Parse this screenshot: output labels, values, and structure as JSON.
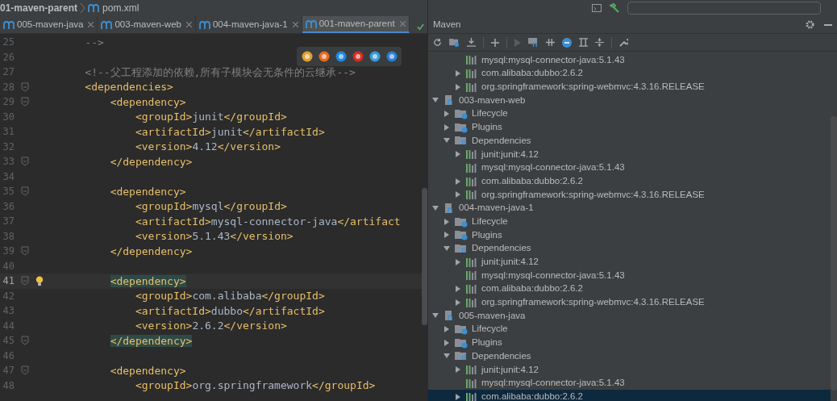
{
  "breadcrumb": [
    "01-maven-parent",
    "pom.xml"
  ],
  "tabs": [
    {
      "label": "005-maven-java",
      "selected": false
    },
    {
      "label": "003-maven-web",
      "selected": false
    },
    {
      "label": "004-maven-java-1",
      "selected": false
    },
    {
      "label": "001-maven-parent",
      "selected": true
    }
  ],
  "editor": {
    "lines": [
      {
        "number": "25",
        "kind": "comment",
        "text": "    -->"
      },
      {
        "number": "26",
        "kind": "code"
      },
      {
        "number": "27",
        "kind": "comment",
        "text": "    <!--父工程添加的依赖,所有子模块会无条件的云继承-->"
      },
      {
        "number": "28",
        "kind": "code",
        "text": "    <dependencies>",
        "fold": true
      },
      {
        "number": "29",
        "kind": "code",
        "text": "        <dependency>",
        "fold": true
      },
      {
        "number": "30",
        "kind": "code",
        "text": "            <groupId>junit</groupId>"
      },
      {
        "number": "31",
        "kind": "code",
        "text": "            <artifactId>junit</artifactId>"
      },
      {
        "number": "32",
        "kind": "code",
        "text": "            <version>4.12</version>"
      },
      {
        "number": "33",
        "kind": "code",
        "text": "        </dependency>",
        "fold": true
      },
      {
        "number": "34",
        "kind": "code"
      },
      {
        "number": "35",
        "kind": "code",
        "text": "        <dependency>",
        "fold": true
      },
      {
        "number": "36",
        "kind": "code",
        "text": "            <groupId>mysql</groupId>"
      },
      {
        "number": "37",
        "kind": "code",
        "text": "            <artifactId>mysql-connector-java</artifact"
      },
      {
        "number": "38",
        "kind": "code",
        "text": "            <version>5.1.43</version>"
      },
      {
        "number": "39",
        "kind": "code",
        "text": "        </dependency>",
        "fold": true
      },
      {
        "number": "40",
        "kind": "code"
      },
      {
        "number": "41",
        "kind": "code",
        "text": "        <dependency>",
        "fold": true,
        "current": true,
        "match_highlight": true,
        "bulb": true
      },
      {
        "number": "42",
        "kind": "code",
        "text": "            <groupId>com.alibaba</groupId>"
      },
      {
        "number": "43",
        "kind": "code",
        "text": "            <artifactId>dubbo</artifactId>"
      },
      {
        "number": "44",
        "kind": "code",
        "text": "            <version>2.6.2</version>"
      },
      {
        "number": "45",
        "kind": "code",
        "text": "        </dependency>",
        "fold": true,
        "match_highlight": true
      },
      {
        "number": "46",
        "kind": "code"
      },
      {
        "number": "47",
        "kind": "code",
        "text": "        <dependency>",
        "fold": true
      },
      {
        "number": "48",
        "kind": "code",
        "text": "            <groupId>org.springframework</groupId>"
      }
    ]
  },
  "maven": {
    "title": "Maven",
    "tree_top": [
      {
        "kind": "dependency",
        "label": "mysql:mysql-connector-java:5.1.43",
        "selected": false
      },
      {
        "kind": "dependency",
        "label": "com.alibaba:dubbo:2.6.2",
        "expanded": false,
        "selected": false
      },
      {
        "kind": "dependency",
        "label": "org.springframework:spring-webmvc:4.3.16.RELEASE",
        "expanded": false,
        "selected": false
      }
    ],
    "tree": [
      {
        "kind": "module",
        "label": "003-maven-web",
        "expanded": true,
        "selected": false,
        "children": [
          {
            "kind": "folder",
            "label": "Lifecycle",
            "expanded": false,
            "selected": false
          },
          {
            "kind": "folder",
            "label": "Plugins",
            "expanded": false,
            "selected": false
          },
          {
            "kind": "deps",
            "label": "Dependencies",
            "expanded": true,
            "selected": false,
            "children": [
              {
                "kind": "dependency",
                "label": "junit:junit:4.12",
                "expanded": false,
                "selected": false
              },
              {
                "kind": "dependency",
                "label": "mysql:mysql-connector-java:5.1.43",
                "selected": false
              },
              {
                "kind": "dependency",
                "label": "com.alibaba:dubbo:2.6.2",
                "expanded": false,
                "selected": false
              },
              {
                "kind": "dependency",
                "label": "org.springframework:spring-webmvc:4.3.16.RELEASE",
                "expanded": false,
                "selected": false
              }
            ]
          }
        ]
      },
      {
        "kind": "module",
        "label": "004-maven-java-1",
        "expanded": true,
        "selected": false,
        "children": [
          {
            "kind": "folder",
            "label": "Lifecycle",
            "expanded": false,
            "selected": false
          },
          {
            "kind": "folder",
            "label": "Plugins",
            "expanded": false,
            "selected": false
          },
          {
            "kind": "deps",
            "label": "Dependencies",
            "expanded": true,
            "selected": false,
            "children": [
              {
                "kind": "dependency",
                "label": "junit:junit:4.12",
                "expanded": false,
                "selected": false
              },
              {
                "kind": "dependency",
                "label": "mysql:mysql-connector-java:5.1.43",
                "selected": false
              },
              {
                "kind": "dependency",
                "label": "com.alibaba:dubbo:2.6.2",
                "expanded": false,
                "selected": false
              },
              {
                "kind": "dependency",
                "label": "org.springframework:spring-webmvc:4.3.16.RELEASE",
                "expanded": false,
                "selected": false
              }
            ]
          }
        ]
      },
      {
        "kind": "module",
        "label": "005-maven-java",
        "expanded": true,
        "selected": false,
        "children": [
          {
            "kind": "folder",
            "label": "Lifecycle",
            "expanded": false,
            "selected": false
          },
          {
            "kind": "folder",
            "label": "Plugins",
            "expanded": false,
            "selected": false
          },
          {
            "kind": "deps",
            "label": "Dependencies",
            "expanded": true,
            "selected": false,
            "children": [
              {
                "kind": "dependency",
                "label": "junit:junit:4.12",
                "expanded": false,
                "selected": false
              },
              {
                "kind": "dependency",
                "label": "mysql:mysql-connector-java:5.1.43",
                "selected": false
              },
              {
                "kind": "dependency",
                "label": "com.alibaba:dubbo:2.6.2",
                "expanded": false,
                "selected": true
              }
            ]
          }
        ]
      }
    ]
  }
}
